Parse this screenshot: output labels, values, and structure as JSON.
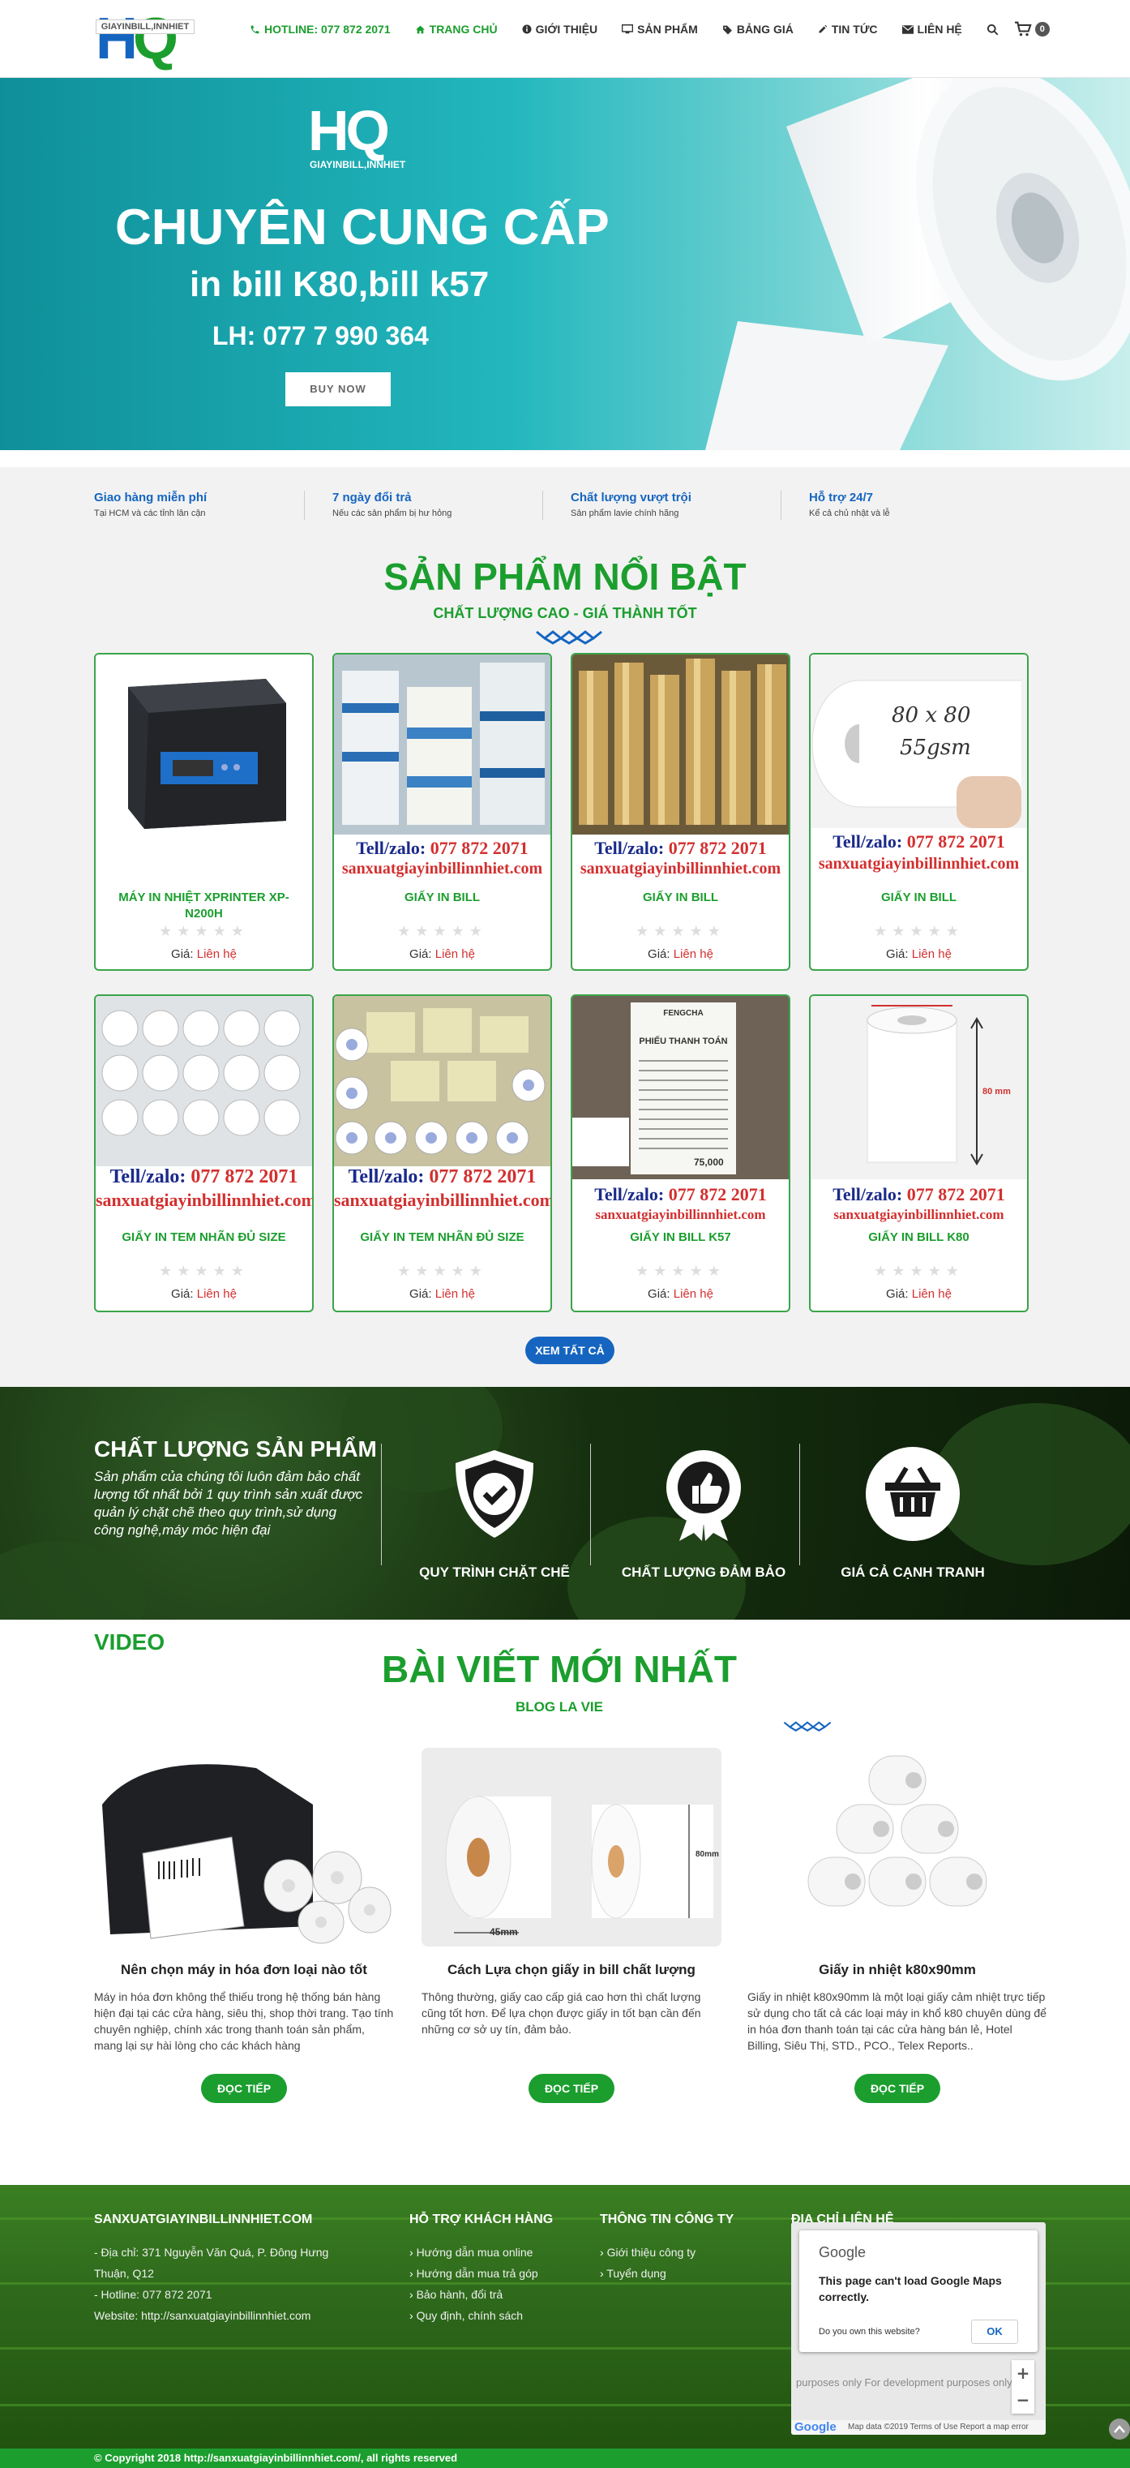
{
  "header": {
    "logo_text": "GIAYINBILL,INNHIET",
    "hotline": "HOTLINE: 077 872 2071",
    "nav": [
      "TRANG CHỦ",
      "GIỚI THIỆU",
      "SẢN PHẨM",
      "BẢNG GIÁ",
      "TIN TỨC",
      "LIÊN HỆ"
    ],
    "cart_count": "0"
  },
  "hero": {
    "logo_sub": "GIAYINBILL,INNHIET",
    "line1": "CHUYÊN CUNG CẤP",
    "line2": "in bill K80,bill k57",
    "line3": "LH: 077 7 990 364",
    "button": "BUY NOW"
  },
  "features": [
    {
      "title": "Giao hàng miễn phí",
      "sub": "Tại HCM và các tỉnh lân cận"
    },
    {
      "title": "7 ngày đổi trả",
      "sub": "Nếu các sản phẩm bị hư hỏng"
    },
    {
      "title": "Chất lượng vượt trội",
      "sub": "Sản phẩm lavie chính hãng"
    },
    {
      "title": "Hỗ trợ 24/7",
      "sub": "Kể cả chủ nhật và lễ"
    }
  ],
  "products_section": {
    "title": "SẢN PHẨM NỔI BẬT",
    "subtitle": "CHẤT LƯỢNG CAO - GIÁ THÀNH TỐT",
    "price_label": "Giá:",
    "price_value": "Liên hệ",
    "tell_label": "Tell/zalo:",
    "tell_number": "077 872 2071",
    "site": "sanxuatgiayinbillinnhiet.com",
    "view_all": "XEM TẤT CẢ",
    "items": [
      {
        "name": "MÁY IN NHIỆT XPRINTER XP-N200H"
      },
      {
        "name": "GIẤY IN BILL"
      },
      {
        "name": "GIẤY IN BILL"
      },
      {
        "name": "GIẤY IN BILL"
      },
      {
        "name": "GIẤY IN TEM NHÃN ĐỦ SIZE"
      },
      {
        "name": "GIẤY IN TEM NHÃN ĐỦ SIZE"
      },
      {
        "name": "GIẤY IN BILL K57"
      },
      {
        "name": "GIẤY IN BILL K80"
      }
    ],
    "img_text_80x80": "80 x 80",
    "img_text_gsm": "55gsm",
    "img_text_80mm": "80 mm",
    "receipt_title": "FENGCHA",
    "receipt_head": "PHIẾU THANH TOÁN",
    "receipt_total": "75,000"
  },
  "quality": {
    "title": "CHẤT LƯỢNG SẢN PHẨM",
    "desc": "Sản phẩm của chúng tôi luôn đảm bảo chất lượng tốt nhất bởi 1 quy trình sản xuất được quản lý chặt chẽ theo quy trình,sử dụng công nghệ,máy móc hiện đại",
    "badges": [
      "QUY TRÌNH CHẶT CHẼ",
      "CHẤT LƯỢNG ĐẢM BẢO",
      "GIÁ CẢ CẠNH TRANH"
    ]
  },
  "video": {
    "title": "VIDEO"
  },
  "blog": {
    "title": "BÀI VIẾT MỚI NHẤT",
    "subtitle": "BLOG LA VIE",
    "more": "ĐỌC TIẾP",
    "img_label_80mm": "80mm",
    "img_label_45mm": "45mm",
    "posts": [
      {
        "title": "Nên chọn máy in hóa đơn loại nào tốt",
        "text": "Máy in hóa đơn không thể thiếu trong hệ thống bán hàng hiện đại tại các cửa hàng, siêu thị, shop thời trang. Tạo tính chuyên nghiệp, chính xác trong thanh toán sản phẩm, mang lại sự hài lòng cho các khách hàng"
      },
      {
        "title": "Cách Lựa chọn giấy in bill chất lượng",
        "text": "Thông thường, giấy cao cấp giá cao hơn thì chất lượng cũng tốt hơn. Để lựa chọn được giấy in tốt bạn cần đến những cơ sở uy tín, đảm bảo."
      },
      {
        "title": "Giấy in nhiệt k80x90mm",
        "text": "Giấy in nhiệt k80x90mm là một loại giấy cảm nhiệt trực tiếp sử dụng cho tất cả các loại máy in khổ k80 chuyên dùng để in hóa đơn thanh toán tại các cửa hàng bán lẻ, Hotel Billing, Siêu Thị, STD., PCO., Telex Reports.."
      }
    ]
  },
  "footer": {
    "col1_title": "SANXUATGIAYINBILLINNHIET.COM",
    "col1_lines": [
      "- Địa chỉ: 371 Nguyễn Văn Quá, P. Đông Hưng",
      "Thuận, Q12",
      "- Hotline: 077 872 2071",
      "Website: http://sanxuatgiayinbillinnhiet.com"
    ],
    "col2_title": "HỖ TRỢ KHÁCH HÀNG",
    "col2_items": [
      "Hướng dẫn mua online",
      "Hướng dẫn mua trả góp",
      "Bảo hành, đổi trả",
      "Quy định, chính sách"
    ],
    "col3_title": "THÔNG TIN CÔNG TY",
    "col3_items": [
      "Giới thiệu công ty",
      "Tuyển dụng"
    ],
    "col4_title": "ĐỊA CHỈ LIÊN HỆ",
    "copyright": "© Copyright 2018 http://sanxuatgiayinbillinnhiet.com/, all rights reserved"
  },
  "map": {
    "google": "Google",
    "message": "This page can't load Google Maps correctly.",
    "question": "Do you own this website?",
    "ok": "OK",
    "dev_text": "purposes only   For development purposes only",
    "footer_text": "Map data ©2019   Terms of Use   Report a map error"
  },
  "colors": {
    "green": "#1b9e2e",
    "blue": "#1565c0",
    "red": "#d32f2f"
  }
}
